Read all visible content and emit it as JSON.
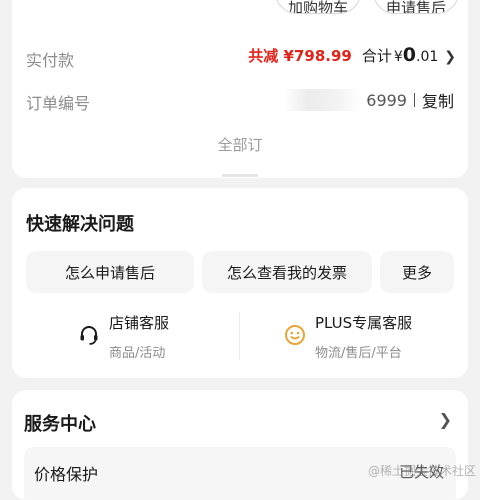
{
  "order_card": {
    "add_cart_label": "加购物车",
    "aftersale_label": "申请售后",
    "paid_label": "实付款",
    "discount_text": "共减 ¥798.99",
    "total_label": "合计",
    "total_symbol": "¥",
    "total_int": "0",
    "total_dec": ".01",
    "order_label": "订单编号",
    "order_number_visible": "6999",
    "copy_label": "复制",
    "all_orders_label": "全部订"
  },
  "quick_solve": {
    "title": "快速解决问题",
    "chips": [
      "怎么申请售后",
      "怎么查看我的发票",
      "更多"
    ],
    "store_service": {
      "title": "店铺客服",
      "subtitle": "商品/活动",
      "icon": "headset-icon"
    },
    "plus_service": {
      "title": "PLUS专属客服",
      "subtitle": "物流/售后/平台",
      "icon": "smile-icon"
    }
  },
  "service_center": {
    "title": "服务中心",
    "price_protect_label": "价格保护",
    "price_protect_status": "已失效"
  },
  "watermark": "@稀土掘金技术社区",
  "colors": {
    "accent_red": "#e2231a",
    "plus_orange": "#e8a53a"
  }
}
